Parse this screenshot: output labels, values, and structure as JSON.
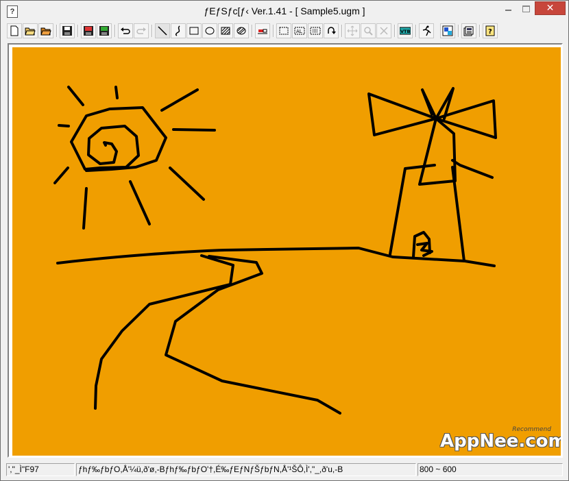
{
  "window": {
    "title": "ƒEƒSƒc[ƒ‹ Ver.1.41 - [ Sample5.ugm ]",
    "app_icon_glyph": "?",
    "close_glyph": "✕"
  },
  "toolbar": {
    "buttons": [
      {
        "name": "new-file-icon",
        "enabled": true
      },
      {
        "name": "open-folder-icon",
        "enabled": true
      },
      {
        "name": "open-folder-icon-2",
        "enabled": true
      },
      {
        "name": "save-disk-icon",
        "enabled": true
      },
      {
        "name": "save-disk-red-icon",
        "enabled": true
      },
      {
        "name": "save-disk-green-icon",
        "enabled": true
      },
      {
        "name": "undo-icon",
        "enabled": true
      },
      {
        "name": "redo-icon",
        "enabled": false
      },
      {
        "name": "line-tool-icon",
        "enabled": true
      },
      {
        "name": "freehand-tool-icon",
        "enabled": true
      },
      {
        "name": "rectangle-tool-icon",
        "enabled": true
      },
      {
        "name": "ellipse-tool-icon",
        "enabled": true
      },
      {
        "name": "filled-rect-tool-icon",
        "enabled": true
      },
      {
        "name": "filled-ellipse-tool-icon",
        "enabled": true
      },
      {
        "name": "eraser-icon",
        "enabled": true
      },
      {
        "name": "select-rect-icon",
        "enabled": true
      },
      {
        "name": "select-all-icon",
        "enabled": true
      },
      {
        "name": "select-grid-icon",
        "enabled": true
      },
      {
        "name": "rotate-icon",
        "enabled": true
      },
      {
        "name": "move-icon",
        "enabled": false
      },
      {
        "name": "zoom-icon",
        "enabled": false
      },
      {
        "name": "delete-icon",
        "enabled": false
      },
      {
        "name": "vtb-icon",
        "enabled": true
      },
      {
        "name": "animate-icon",
        "enabled": true
      },
      {
        "name": "palette-icon",
        "enabled": true
      },
      {
        "name": "properties-icon",
        "enabled": true
      },
      {
        "name": "help-icon",
        "enabled": true
      }
    ],
    "vtb_label": "VTB"
  },
  "colors": {
    "canvas_bg": "#f09e00",
    "stroke": "#000000",
    "close_button": "#c7463b"
  },
  "watermark": {
    "text": "AppNee.com",
    "sub": "Recommend"
  },
  "status": {
    "left": "',\"_Ì\"F97",
    "middle": "ƒhƒ‰ƒbƒO,Å'¼ü,ð'ø,-Bƒhƒ‰ƒbƒO'†,É‰ƒEƒNƒŠƒbƒN,Å'¹ŠÔ,Ì',\"_,ð'u,-B",
    "right": "800 ~ 600"
  }
}
